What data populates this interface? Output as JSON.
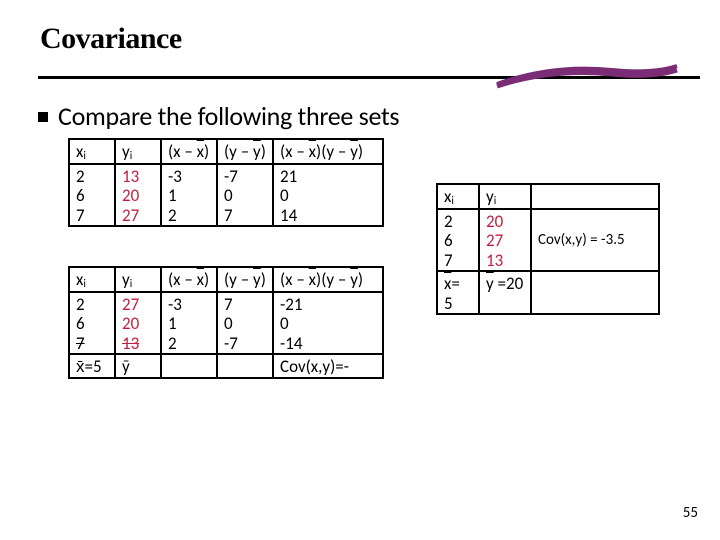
{
  "title": "Covariance",
  "bullet": "Compare the following three sets",
  "table1": {
    "headers": {
      "c1": "xᵢ",
      "c2": "yᵢ",
      "c3": "(x – x̄)",
      "c4": "(y – ȳ)",
      "c5": "(x – x̄)(y – ȳ)"
    },
    "rows": [
      [
        "2",
        "13",
        "-3",
        "-7",
        "21"
      ],
      [
        "6",
        "20",
        "1",
        "0",
        "0"
      ],
      [
        "7",
        "27",
        "2",
        "7",
        "14"
      ]
    ]
  },
  "table2": {
    "headers": {
      "c1": "xᵢ",
      "c2": "yᵢ",
      "c3": "(x – x̄)",
      "c4": "(y – ȳ)",
      "c5": "(x – x̄)(y – ȳ)"
    },
    "rows": [
      [
        "2",
        "27",
        "-3",
        "7",
        "-21"
      ],
      [
        "6",
        "20",
        "1",
        "0",
        "0"
      ],
      [
        "7",
        "13",
        "2",
        "-7",
        "-14"
      ]
    ],
    "footer": {
      "c1": "x̄=5",
      "c2": "ȳ",
      "c5": "Cov(x,y)=-"
    }
  },
  "table3": {
    "headers": {
      "c1": "xᵢ",
      "c2": "yᵢ",
      "c3": ""
    },
    "rows": [
      [
        "2",
        "20",
        ""
      ],
      [
        "6",
        "27",
        "Cov(x,y) = -3.5"
      ],
      [
        "7",
        "13",
        ""
      ]
    ],
    "footer": {
      "c1": "x̄= 5",
      "c2": "ȳ =20",
      "c3": ""
    }
  },
  "page_number": "55"
}
